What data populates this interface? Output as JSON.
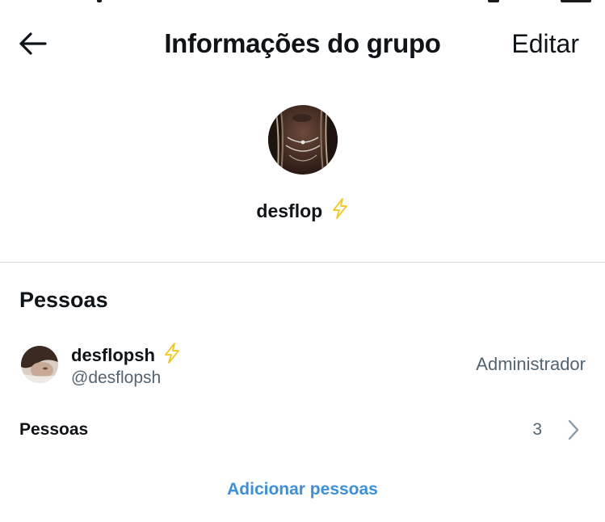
{
  "header": {
    "title": "Informações do grupo",
    "edit_label": "Editar",
    "back_icon": "arrow-left-icon"
  },
  "group": {
    "name": "desflop",
    "badge_icon": "lightning-bolt-icon",
    "avatar": "group-photo"
  },
  "people_section": {
    "title": "Pessoas",
    "members": [
      {
        "name": "desflopsh",
        "handle": "@desflopsh",
        "role": "Administrador",
        "badge_icon": "lightning-bolt-icon"
      }
    ],
    "people_row": {
      "label": "Pessoas",
      "count": "3",
      "icon": "chevron-right-icon"
    },
    "add_label": "Adicionar pessoas"
  },
  "colors": {
    "text": "#0f1419",
    "secondary": "#536471",
    "link": "#3b8fdc",
    "divider": "#cfd9de",
    "bolt": "#f5c518"
  }
}
